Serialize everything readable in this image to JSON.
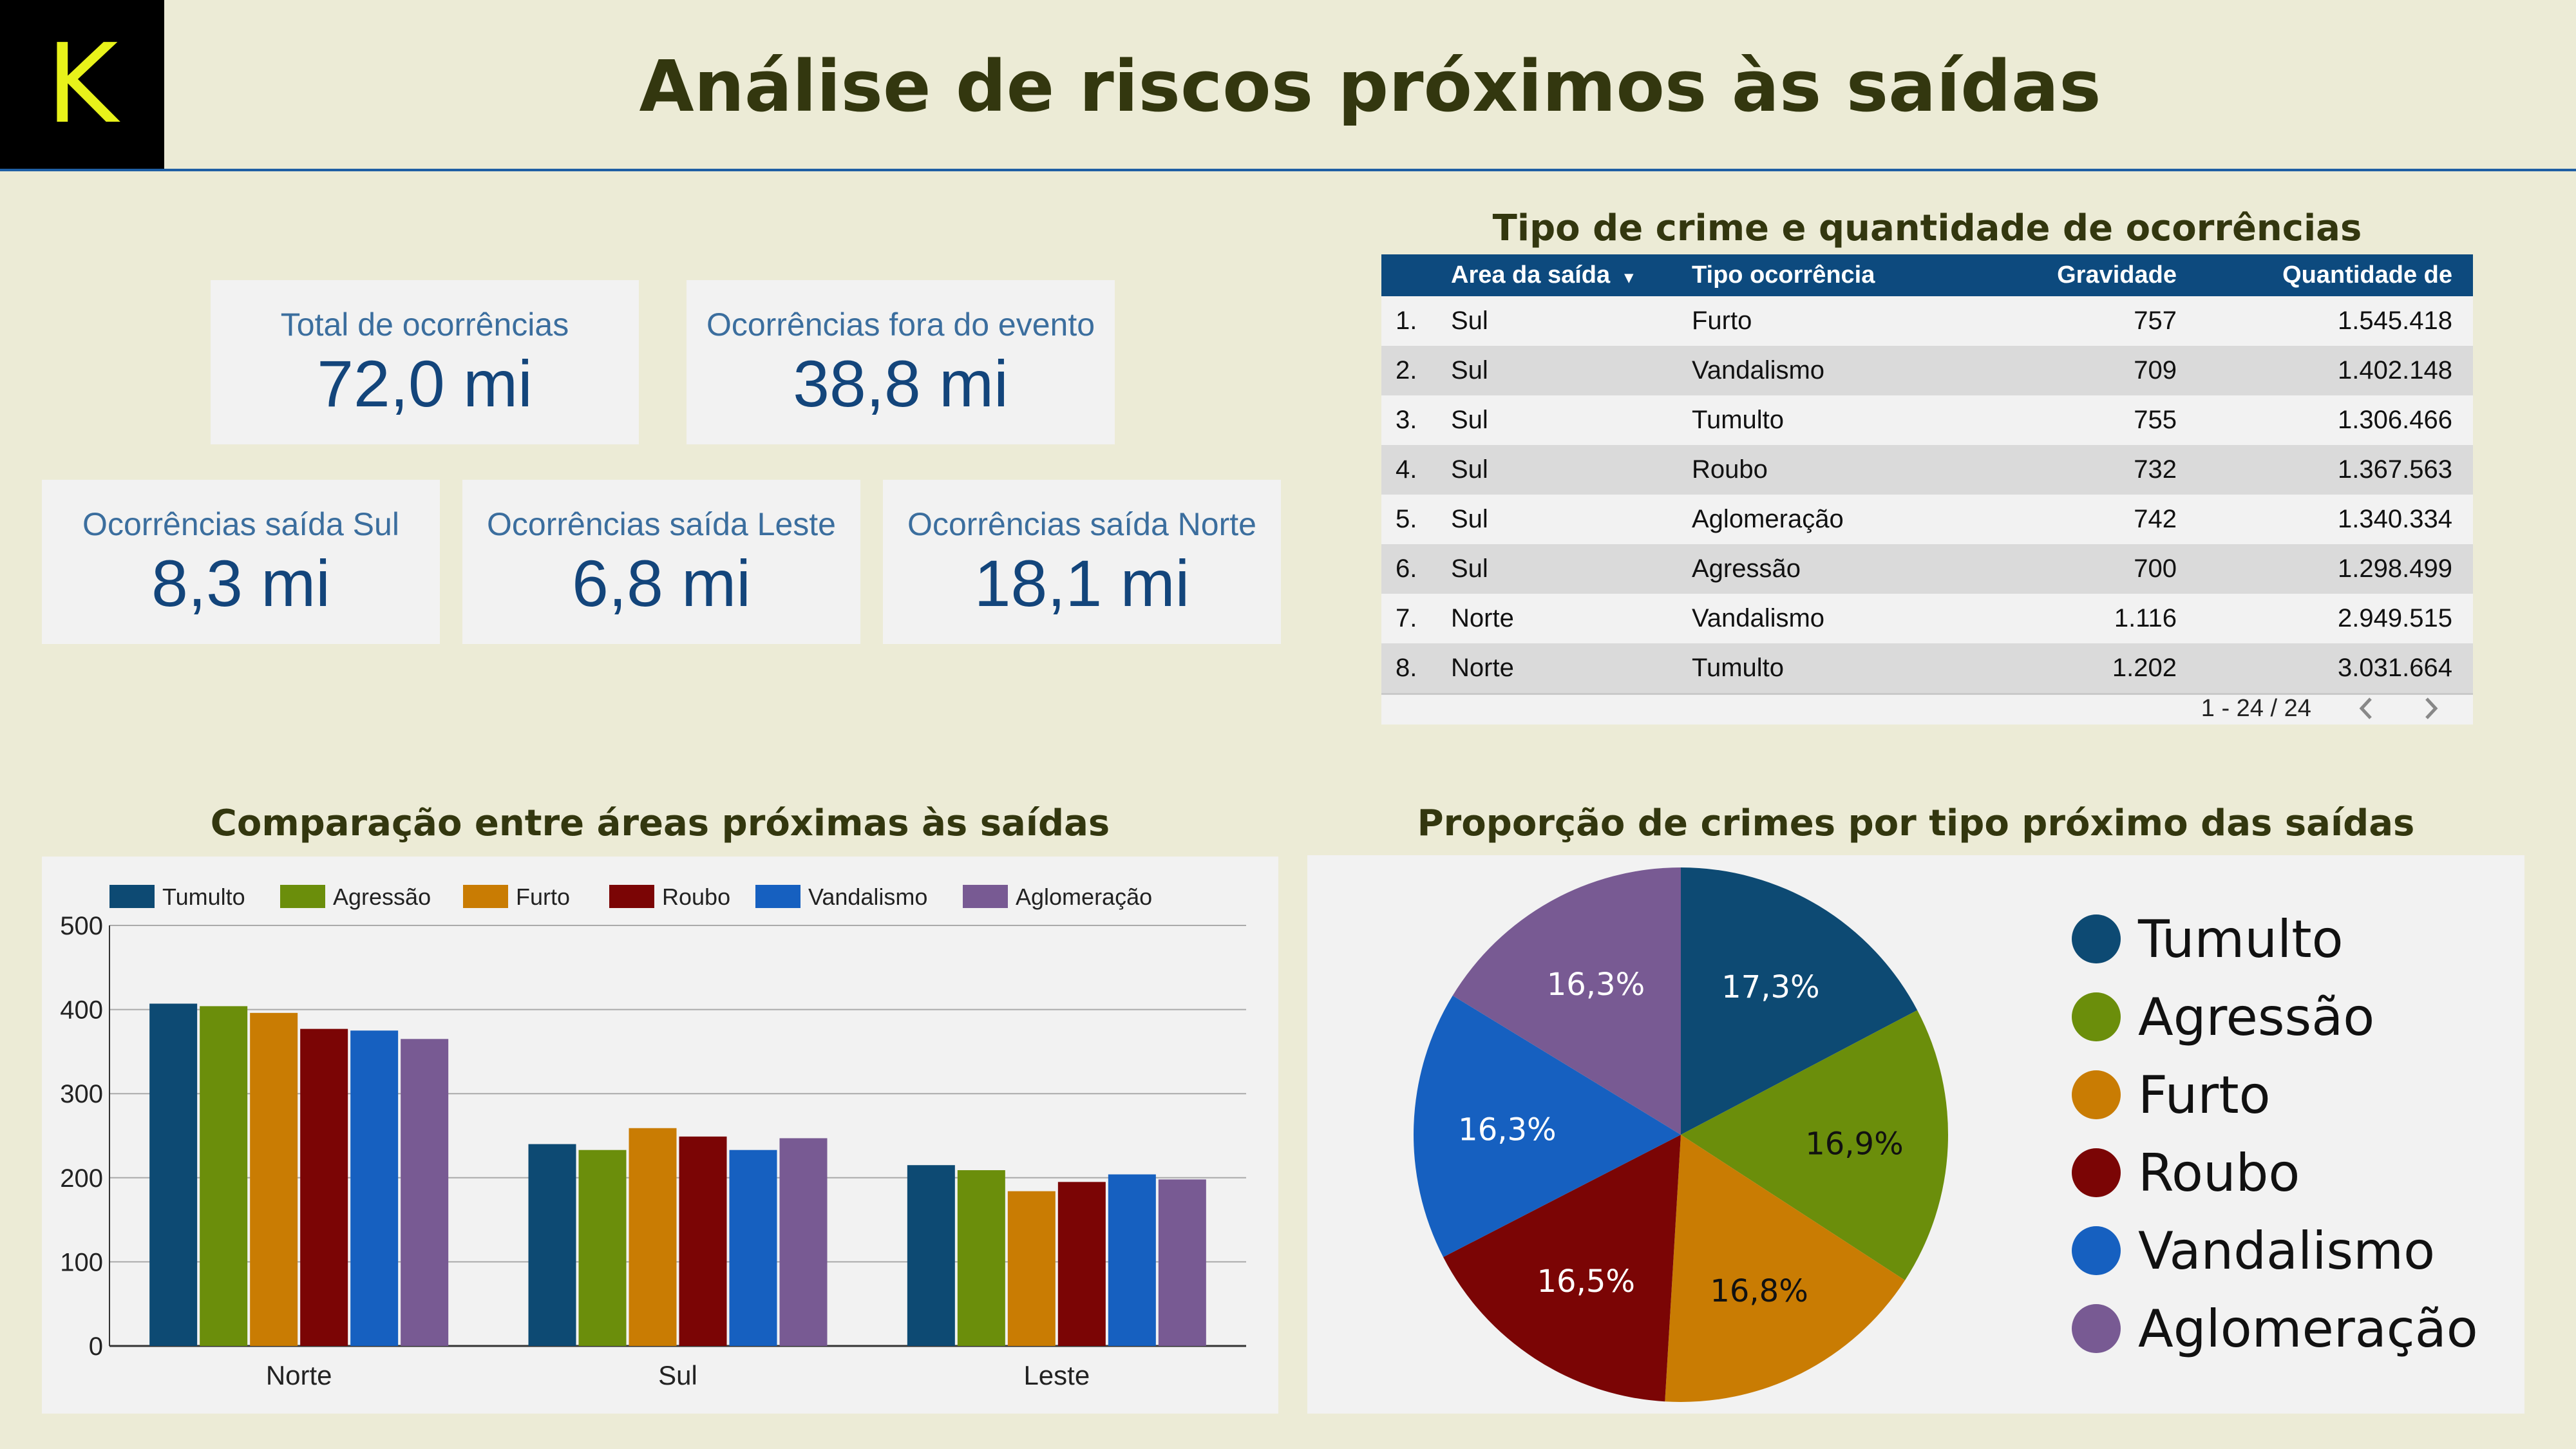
{
  "logo": {
    "letter": "K"
  },
  "header": {
    "title": "Análise de riscos próximos às saídas"
  },
  "kpis": [
    {
      "label": "Total de ocorrências",
      "value": "72,0 mi"
    },
    {
      "label": "Ocorrências fora do evento",
      "value": "38,8 mi"
    },
    {
      "label": "Ocorrências saída Sul",
      "value": "8,3 mi"
    },
    {
      "label": "Ocorrências saída Leste",
      "value": "6,8 mi"
    },
    {
      "label": "Ocorrências saída Norte",
      "value": "18,1 mi"
    }
  ],
  "table": {
    "title": "Tipo de crime e quantidade de ocorrências",
    "columns": [
      "Area da saída",
      "Tipo ocorrência",
      "Gravidade",
      "Quantidade de ocorrências"
    ],
    "sort_indicator": "▾",
    "rows": [
      {
        "num": "1.",
        "area": "Sul",
        "tipo": "Furto",
        "grav": "757",
        "qtd": "1.545.418"
      },
      {
        "num": "2.",
        "area": "Sul",
        "tipo": "Vandalismo",
        "grav": "709",
        "qtd": "1.402.148"
      },
      {
        "num": "3.",
        "area": "Sul",
        "tipo": "Tumulto",
        "grav": "755",
        "qtd": "1.306.466"
      },
      {
        "num": "4.",
        "area": "Sul",
        "tipo": "Roubo",
        "grav": "732",
        "qtd": "1.367.563"
      },
      {
        "num": "5.",
        "area": "Sul",
        "tipo": "Aglomeração",
        "grav": "742",
        "qtd": "1.340.334"
      },
      {
        "num": "6.",
        "area": "Sul",
        "tipo": "Agressão",
        "grav": "700",
        "qtd": "1.298.499"
      },
      {
        "num": "7.",
        "area": "Norte",
        "tipo": "Vandalismo",
        "grav": "1.116",
        "qtd": "2.949.515"
      },
      {
        "num": "8.",
        "area": "Norte",
        "tipo": "Tumulto",
        "grav": "1.202",
        "qtd": "3.031.664"
      }
    ],
    "pagination": "1 - 24 / 24"
  },
  "bar_chart_title": "Comparação entre áreas próximas às saídas",
  "pie_chart_title": "Proporção de crimes por tipo próximo das saídas",
  "colors": {
    "Tumulto": "#0d4a73",
    "Agressão": "#6b8e0b",
    "Furto": "#c97c03",
    "Roubo": "#7b0505",
    "Vandalismo": "#1660c0",
    "Aglomeração": "#785a93"
  },
  "chart_data": [
    {
      "type": "bar",
      "title": "Comparação entre áreas próximas às saídas",
      "categories": [
        "Norte",
        "Sul",
        "Leste"
      ],
      "ylim": [
        0,
        500
      ],
      "yticks": [
        0,
        100,
        200,
        300,
        400,
        500
      ],
      "grid": true,
      "legend": "top",
      "series": [
        {
          "name": "Tumulto",
          "values": [
            407,
            240,
            215
          ]
        },
        {
          "name": "Agressão",
          "values": [
            404,
            233,
            209
          ]
        },
        {
          "name": "Furto",
          "values": [
            396,
            259,
            184
          ]
        },
        {
          "name": "Roubo",
          "values": [
            377,
            249,
            195
          ]
        },
        {
          "name": "Vandalismo",
          "values": [
            375,
            233,
            204
          ]
        },
        {
          "name": "Aglomeração",
          "values": [
            365,
            247,
            198
          ]
        }
      ]
    },
    {
      "type": "pie",
      "title": "Proporção de crimes por tipo próximo das saídas",
      "legend": "right",
      "labels": [
        "Tumulto",
        "Agressão",
        "Furto",
        "Roubo",
        "Vandalismo",
        "Aglomeração"
      ],
      "values": [
        17.3,
        16.9,
        16.8,
        16.5,
        16.3,
        16.3
      ],
      "value_labels": [
        "17,3%",
        "16,9%",
        "16,8%",
        "16,5%",
        "16,3%",
        "16,3%"
      ]
    }
  ]
}
